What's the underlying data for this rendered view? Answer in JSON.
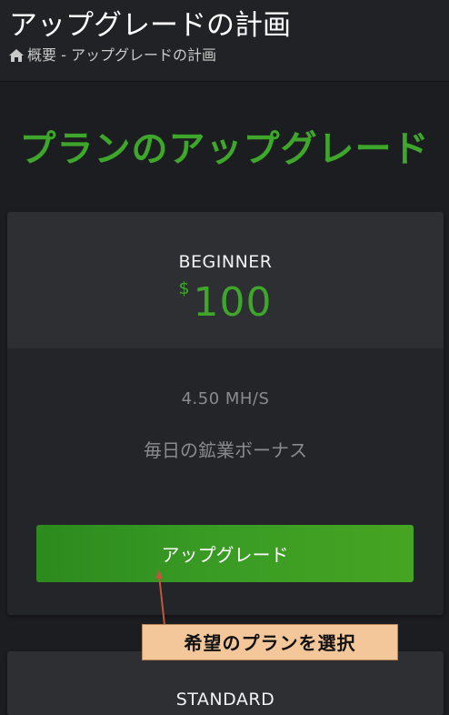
{
  "header": {
    "title": "アップグレードの計画",
    "breadcrumb_icon": "home-icon",
    "breadcrumb": "概要 - アップグレードの計画"
  },
  "section": {
    "heading": "プランのアップグレード"
  },
  "plans": [
    {
      "name": "BEGINNER",
      "currency": "$",
      "price": "100",
      "features": [
        "4.50 MH/S",
        "毎日の鉱業ボーナス"
      ],
      "button_label": "アップグレード"
    },
    {
      "name": "STANDARD"
    }
  ],
  "annotation": {
    "label": "希望のプランを選択"
  },
  "colors": {
    "accent": "#3ea62b",
    "background": "#1c1d20",
    "card": "#242528",
    "card_header": "#2e2f33",
    "callout_bg": "#f4c79a",
    "pointer": "#c0563a"
  }
}
